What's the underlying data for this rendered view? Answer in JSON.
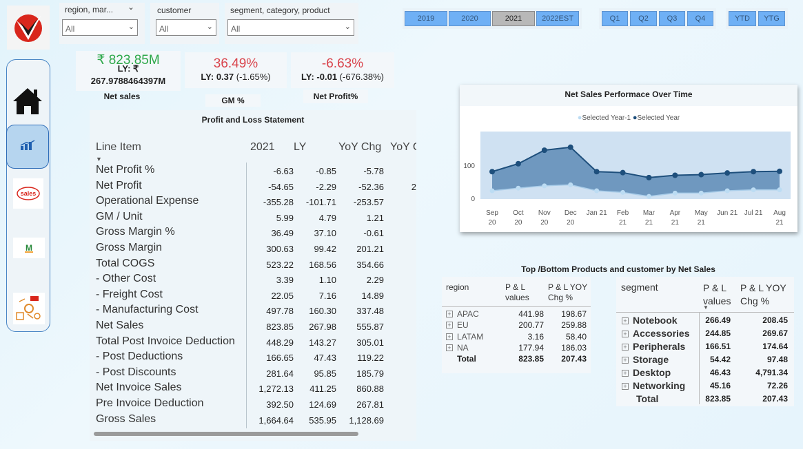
{
  "brand": {
    "accent": "#d9261c",
    "button_blue": "#6fb0f5",
    "button_selected": "#b8b8b8",
    "area_fill": "#6f98bf",
    "line_color": "#1e4f7c"
  },
  "nav": {
    "items": [
      {
        "name": "home",
        "icon": "home-icon"
      },
      {
        "name": "finance",
        "icon": "bar-chart-icon"
      },
      {
        "name": "sales",
        "icon": "sales-icon",
        "label": "sales"
      },
      {
        "name": "marketing",
        "icon": "marketing-icon",
        "label": "M"
      },
      {
        "name": "supply-chain",
        "icon": "supply-chain-icon"
      }
    ]
  },
  "slicers": {
    "region": {
      "label": "region, mar...",
      "value": "All"
    },
    "customer": {
      "label": "customer",
      "value": "All"
    },
    "segment": {
      "label": "segment, category, product",
      "value": "All"
    }
  },
  "years": [
    "2019",
    "2020",
    "2021",
    "2022EST"
  ],
  "selected_year": "2021",
  "quarters": [
    "Q1",
    "Q2",
    "Q3",
    "Q4"
  ],
  "periods": [
    "YTD",
    "YTG"
  ],
  "kpis": {
    "net_sales": {
      "value": "₹ 823.85M",
      "ly_line1": "LY: ₹",
      "ly_line2": "267.9788464397M",
      "label": "Net sales",
      "color": "#2ea84a"
    },
    "gm": {
      "value": "36.49%",
      "ly_prefix": "LY: ",
      "ly_value": "0.37",
      "ly_chg": " (-1.65%)",
      "label": "GM %",
      "color": "#d9434b"
    },
    "net_profit": {
      "value": "-6.63%",
      "ly_prefix": "LY: ",
      "ly_value": "-0.01",
      "ly_chg": " (-676.38%)",
      "label": "Net Profit%",
      "color": "#d9434b"
    }
  },
  "pl": {
    "title": "Profit and Loss Statement",
    "headers": [
      "Line Item",
      "2021",
      "LY",
      "YoY Chg",
      "YoY C"
    ],
    "rows": [
      {
        "item": "Net Profit %",
        "v2021": "-6.63",
        "ly": "-0.85",
        "chg": "-5.78",
        "extra": ""
      },
      {
        "item": "Net Profit",
        "v2021": "-54.65",
        "ly": "-2.29",
        "chg": "-52.36",
        "extra": "2"
      },
      {
        "item": "Operational Expense",
        "v2021": "-355.28",
        "ly": "-101.71",
        "chg": "-253.57",
        "extra": ""
      },
      {
        "item": "GM / Unit",
        "v2021": "5.99",
        "ly": "4.79",
        "chg": "1.21",
        "extra": ""
      },
      {
        "item": "Gross Margin %",
        "v2021": "36.49",
        "ly": "37.10",
        "chg": "-0.61",
        "extra": ""
      },
      {
        "item": "Gross Margin",
        "v2021": "300.63",
        "ly": "99.42",
        "chg": "201.21",
        "extra": ""
      },
      {
        "item": "Total COGS",
        "v2021": "523.22",
        "ly": "168.56",
        "chg": "354.66",
        "extra": ""
      },
      {
        "item": "- Other Cost",
        "v2021": "3.39",
        "ly": "1.10",
        "chg": "2.29",
        "extra": ""
      },
      {
        "item": "- Freight Cost",
        "v2021": "22.05",
        "ly": "7.16",
        "chg": "14.89",
        "extra": ""
      },
      {
        "item": "- Manufacturing Cost",
        "v2021": "497.78",
        "ly": "160.30",
        "chg": "337.48",
        "extra": ""
      },
      {
        "item": "Net Sales",
        "v2021": "823.85",
        "ly": "267.98",
        "chg": "555.87",
        "extra": ""
      },
      {
        "item": "Total Post Invoice Deduction",
        "v2021": "448.29",
        "ly": "143.27",
        "chg": "305.01",
        "extra": ""
      },
      {
        "item": "- Post Deductions",
        "v2021": "166.65",
        "ly": "47.43",
        "chg": "119.22",
        "extra": ""
      },
      {
        "item": "- Post Discounts",
        "v2021": "281.64",
        "ly": "95.85",
        "chg": "185.79",
        "extra": ""
      },
      {
        "item": "Net Invoice Sales",
        "v2021": "1,272.13",
        "ly": "411.25",
        "chg": "860.88",
        "extra": ""
      },
      {
        "item": "Pre Invoice Deduction",
        "v2021": "392.50",
        "ly": "124.69",
        "chg": "267.81",
        "extra": ""
      },
      {
        "item": "Gross Sales",
        "v2021": "1,664.64",
        "ly": "535.95",
        "chg": "1,128.69",
        "extra": ""
      }
    ]
  },
  "chart_data": {
    "type": "area",
    "title": "Net Sales Performace Over Time",
    "legend_placement": "top-center",
    "series": [
      {
        "name": "Selected Year-1",
        "color": "#bcdcf3",
        "values": [
          25,
          33,
          40,
          43,
          25,
          20,
          8,
          18,
          18,
          25,
          28,
          28
        ]
      },
      {
        "name": "Selected Year",
        "color": "#1e4f7c",
        "values": [
          83,
          107,
          148,
          157,
          83,
          80,
          65,
          72,
          74,
          79,
          83,
          84
        ]
      }
    ],
    "x": [
      "Sep 20",
      "Oct 20",
      "Nov 20",
      "Dec 20",
      "Jan 21",
      "Feb 21",
      "Mar 21",
      "Apr 21",
      "May 21",
      "Jun 21",
      "Jul 21",
      "Aug 21"
    ],
    "x_ticks": [
      [
        "Sep",
        "20"
      ],
      [
        "Oct",
        "20"
      ],
      [
        "Nov",
        "20"
      ],
      [
        "Dec",
        "20"
      ],
      [
        "Jan 21",
        ""
      ],
      [
        "Feb",
        "21"
      ],
      [
        "Mar",
        "21"
      ],
      [
        "Apr",
        "21"
      ],
      [
        "May",
        "21"
      ],
      [
        "Jun 21",
        ""
      ],
      [
        "Jul 21",
        ""
      ],
      [
        "Aug",
        "21"
      ]
    ],
    "y_ticks": [
      "0",
      "100"
    ],
    "ylim": [
      0,
      190
    ],
    "grid": false
  },
  "top_bottom": {
    "title": "Top /Bottom  Products and customer by Net Sales",
    "region_headers": [
      "region",
      "P & L values",
      "P & L YOY Chg %"
    ],
    "regions": [
      {
        "name": "APAC",
        "value": "441.98",
        "chg": "198.67"
      },
      {
        "name": "EU",
        "value": "200.77",
        "chg": "259.88"
      },
      {
        "name": "LATAM",
        "value": "3.16",
        "chg": "58.40"
      },
      {
        "name": "NA",
        "value": "177.94",
        "chg": "186.03"
      }
    ],
    "region_total": {
      "name": "Total",
      "value": "823.85",
      "chg": "207.43"
    },
    "segment_headers": [
      "segment",
      "P & L values",
      "P & L YOY Chg %"
    ],
    "segments": [
      {
        "name": "Notebook",
        "value": "266.49",
        "chg": "208.45"
      },
      {
        "name": "Accessories",
        "value": "244.85",
        "chg": "269.67"
      },
      {
        "name": "Peripherals",
        "value": "166.51",
        "chg": "174.64"
      },
      {
        "name": "Storage",
        "value": "54.42",
        "chg": "97.48"
      },
      {
        "name": "Desktop",
        "value": "46.43",
        "chg": "4,791.34"
      },
      {
        "name": "Networking",
        "value": "45.16",
        "chg": "72.26"
      }
    ],
    "segment_total": {
      "name": "Total",
      "value": "823.85",
      "chg": "207.43"
    }
  }
}
